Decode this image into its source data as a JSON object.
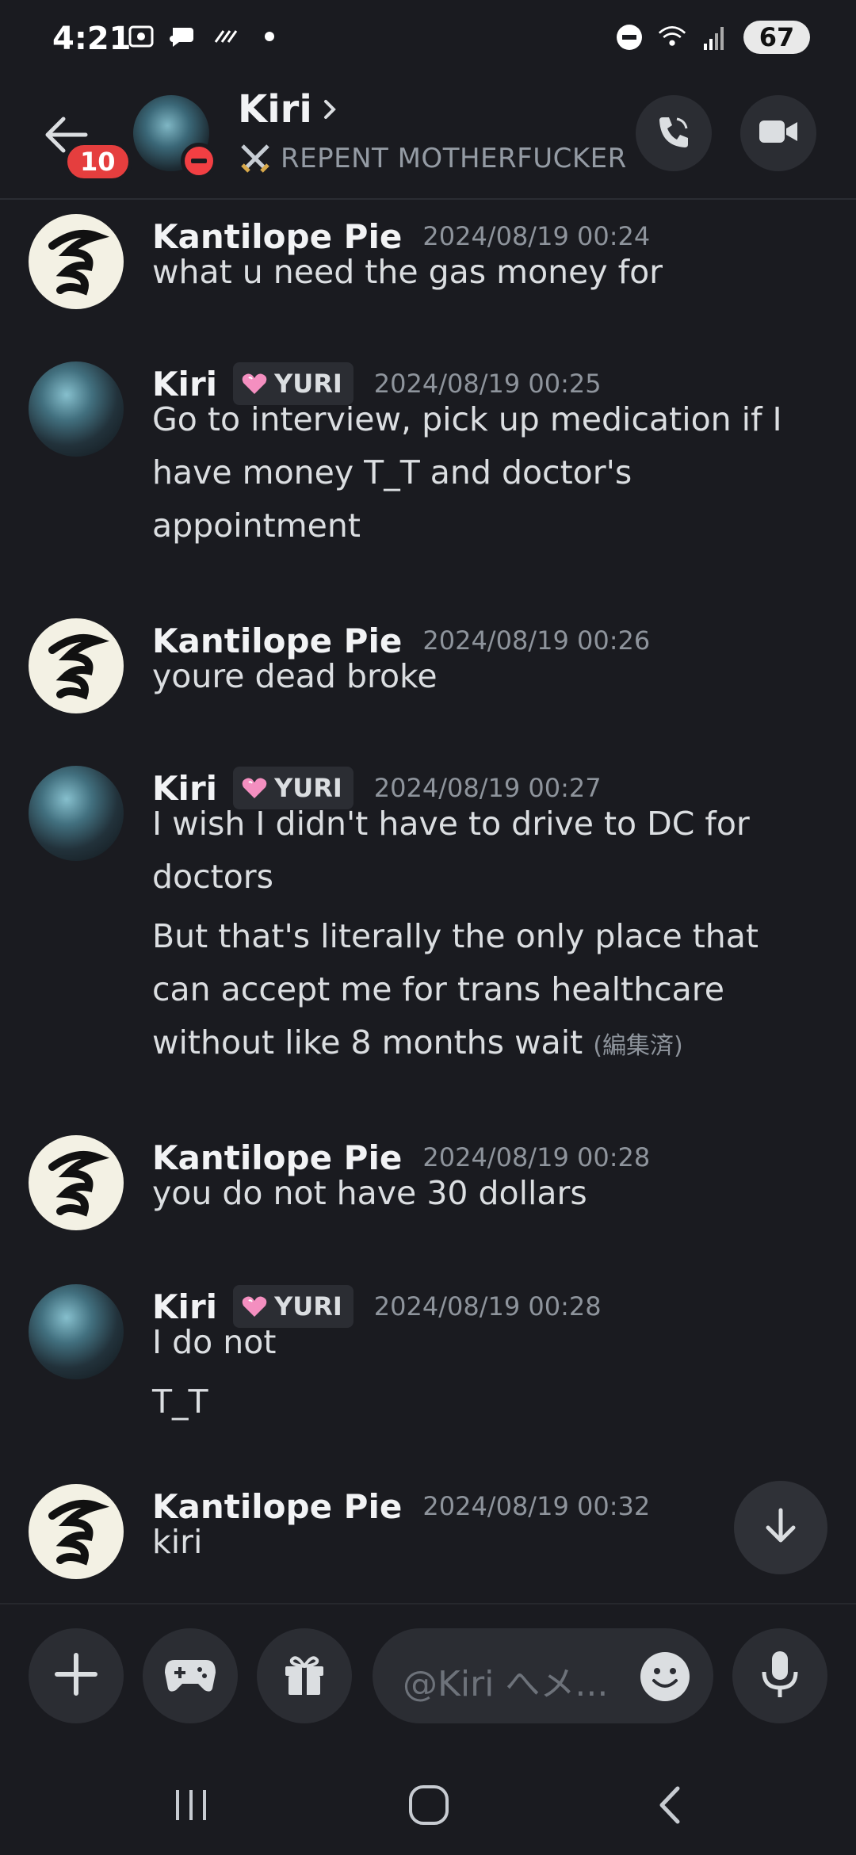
{
  "status_bar": {
    "time": "4:21",
    "battery": "67"
  },
  "header": {
    "unread_count": "10",
    "name": "Kiri",
    "status": "REPENT MOTHERFUCKER",
    "colors": {
      "dnd": "#f23f43",
      "badge": "#e53e3e"
    }
  },
  "messages": [
    {
      "author": "Kantilope Pie",
      "time": "2024/08/19 00:24",
      "lines": [
        "what u need the gas money for"
      ]
    },
    {
      "author": "Kiri",
      "role": "YURI",
      "time": "2024/08/19 00:25",
      "lines": [
        "Go to interview, pick up medication if I",
        "have money T_T and doctor's",
        "appointment"
      ]
    },
    {
      "author": "Kantilope Pie",
      "time": "2024/08/19 00:26",
      "lines": [
        "youre dead broke"
      ]
    },
    {
      "author": "Kiri",
      "role": "YURI",
      "time": "2024/08/19 00:27",
      "lines": [
        "I wish I didn't have to drive to DC for",
        "doctors",
        "But that's literally the only place that",
        "can accept me for trans healthcare",
        "without like 8 months wait"
      ],
      "edited": "(編集済)"
    },
    {
      "author": "Kantilope Pie",
      "time": "2024/08/19 00:28",
      "lines": [
        "you do not have 30 dollars"
      ]
    },
    {
      "author": "Kiri",
      "role": "YURI",
      "time": "2024/08/19 00:28",
      "lines": [
        "I do not",
        "T_T"
      ]
    },
    {
      "author": "Kantilope Pie",
      "time": "2024/08/19 00:32",
      "lines": [
        "kiri"
      ]
    }
  ],
  "composer": {
    "placeholder": "@Kiri へメ..."
  }
}
